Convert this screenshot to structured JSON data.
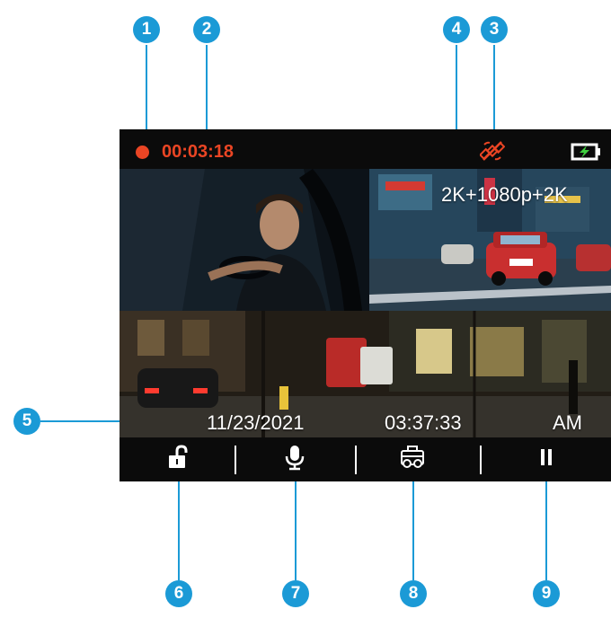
{
  "callouts": [
    "1",
    "2",
    "3",
    "4",
    "5",
    "6",
    "7",
    "8",
    "9"
  ],
  "status_bar": {
    "recording_time": "00:03:18",
    "rec_color": "#ea4524",
    "gps_icon": "gps-off-satellite-icon",
    "battery_icon": "battery-charging-icon",
    "charge_color": "#3fcf3f"
  },
  "video": {
    "resolution": "2K+1080p+2K"
  },
  "overlay": {
    "date": "11/23/2021",
    "time": "03:37:33",
    "meridiem": "AM"
  },
  "toolbar": {
    "lock": "lock-open-icon",
    "mic": "microphone-icon",
    "camera": "camera-switch-icon",
    "pause": "pause-icon"
  },
  "accent_color": "#1b9ad6"
}
